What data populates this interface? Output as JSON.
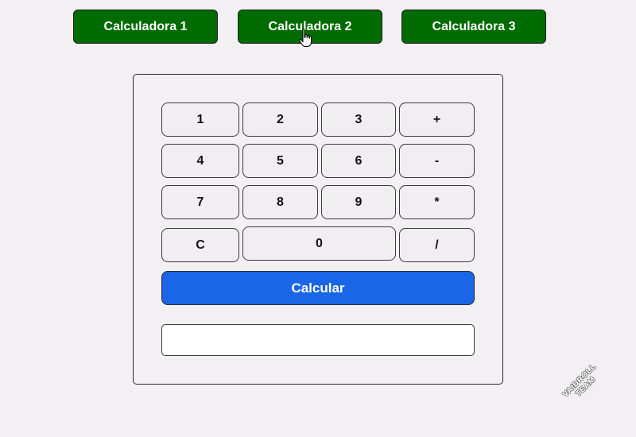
{
  "nav": {
    "buttons": [
      {
        "label": "Calculadora 1"
      },
      {
        "label": "Calculadora 2"
      },
      {
        "label": "Calculadora 3"
      }
    ]
  },
  "calculator": {
    "rows": [
      [
        "1",
        "2",
        "3",
        "+"
      ],
      [
        "4",
        "5",
        "6",
        "-"
      ],
      [
        "7",
        "8",
        "9",
        "*"
      ],
      [
        "C",
        "0",
        "/"
      ]
    ],
    "calculate_label": "Calcular",
    "result_value": ""
  },
  "watermark": {
    "line1": "VAIDROLL",
    "line2": "TEAM"
  },
  "colors": {
    "nav_button": "#006b00",
    "calculate_button": "#1a66e6",
    "background": "#f2f0f2"
  }
}
